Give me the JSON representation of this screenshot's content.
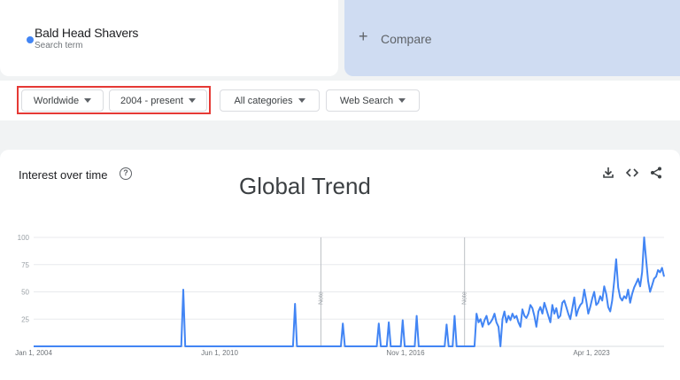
{
  "search_term": {
    "name": "Bald Head Shavers",
    "subtitle": "Search term",
    "color": "#4285f4"
  },
  "compare": {
    "plus": "+",
    "label": "Compare"
  },
  "filters": {
    "region": "Worldwide",
    "time_range": "2004 - present",
    "category": "All categories",
    "search_type": "Web Search"
  },
  "chart_panel": {
    "title": "Interest over time",
    "help_icon": "help-circle-icon",
    "overlay_title": "Global Trend",
    "tools": [
      "download-icon",
      "embed-code-icon",
      "share-icon"
    ]
  },
  "chart_data": {
    "type": "line",
    "title": "Interest over time",
    "ylim": [
      0,
      100
    ],
    "y_ticks": [
      100,
      75,
      50,
      25
    ],
    "x_tick_labels": [
      "Jan 1, 2004",
      "Jun 1, 2010",
      "Nov 1, 2016",
      "Apr 1, 2023"
    ],
    "notes": [
      {
        "date": "2016-01",
        "label": "Note"
      },
      {
        "date": "2022-01",
        "label": "Note"
      }
    ],
    "grid": true,
    "color": "#4285f4",
    "x_start": "2004-01",
    "series": [
      {
        "name": "Bald Head Shavers",
        "values": [
          0,
          0,
          0,
          0,
          0,
          0,
          0,
          0,
          0,
          0,
          0,
          0,
          0,
          0,
          0,
          0,
          0,
          0,
          0,
          0,
          0,
          0,
          0,
          0,
          0,
          0,
          0,
          0,
          0,
          0,
          0,
          0,
          0,
          0,
          0,
          0,
          0,
          0,
          0,
          0,
          0,
          0,
          0,
          0,
          0,
          0,
          0,
          0,
          0,
          0,
          0,
          0,
          0,
          0,
          0,
          0,
          0,
          0,
          0,
          0,
          0,
          0,
          0,
          0,
          0,
          0,
          0,
          0,
          0,
          0,
          0,
          0,
          0,
          0,
          0,
          52,
          0,
          0,
          0,
          0,
          0,
          0,
          0,
          0,
          0,
          0,
          0,
          0,
          0,
          0,
          0,
          0,
          0,
          0,
          0,
          0,
          0,
          0,
          0,
          0,
          0,
          0,
          0,
          0,
          0,
          0,
          0,
          0,
          0,
          0,
          0,
          0,
          0,
          0,
          0,
          0,
          0,
          0,
          0,
          0,
          0,
          0,
          0,
          0,
          0,
          0,
          0,
          0,
          0,
          0,
          0,
          39,
          0,
          0,
          0,
          0,
          0,
          0,
          0,
          0,
          0,
          0,
          0,
          0,
          0,
          0,
          0,
          0,
          0,
          0,
          0,
          0,
          0,
          0,
          0,
          21,
          0,
          0,
          0,
          0,
          0,
          0,
          0,
          0,
          0,
          0,
          0,
          0,
          0,
          0,
          0,
          0,
          0,
          21,
          0,
          0,
          0,
          0,
          22,
          0,
          0,
          0,
          0,
          0,
          0,
          24,
          0,
          0,
          0,
          0,
          0,
          0,
          28,
          0,
          0,
          0,
          0,
          0,
          0,
          0,
          0,
          0,
          0,
          0,
          0,
          0,
          0,
          20,
          0,
          0,
          0,
          28,
          0,
          0,
          0,
          0,
          0,
          0,
          0,
          0,
          0,
          0,
          30,
          22,
          25,
          18,
          24,
          28,
          20,
          22,
          25,
          30,
          22,
          18,
          0,
          25,
          32,
          22,
          28,
          24,
          30,
          26,
          28,
          22,
          18,
          34,
          28,
          26,
          30,
          38,
          35,
          28,
          18,
          32,
          36,
          30,
          40,
          34,
          28,
          22,
          38,
          30,
          35,
          26,
          28,
          40,
          42,
          36,
          30,
          25,
          35,
          45,
          28,
          34,
          38,
          40,
          52,
          42,
          30,
          36,
          44,
          50,
          38,
          40,
          46,
          42,
          55,
          48,
          36,
          32,
          42,
          60,
          80,
          54,
          45,
          42,
          46,
          44,
          52,
          40,
          48,
          54,
          58,
          62,
          55,
          68,
          100,
          80,
          60,
          50,
          56,
          62,
          64,
          70,
          68,
          72,
          64
        ]
      }
    ]
  }
}
